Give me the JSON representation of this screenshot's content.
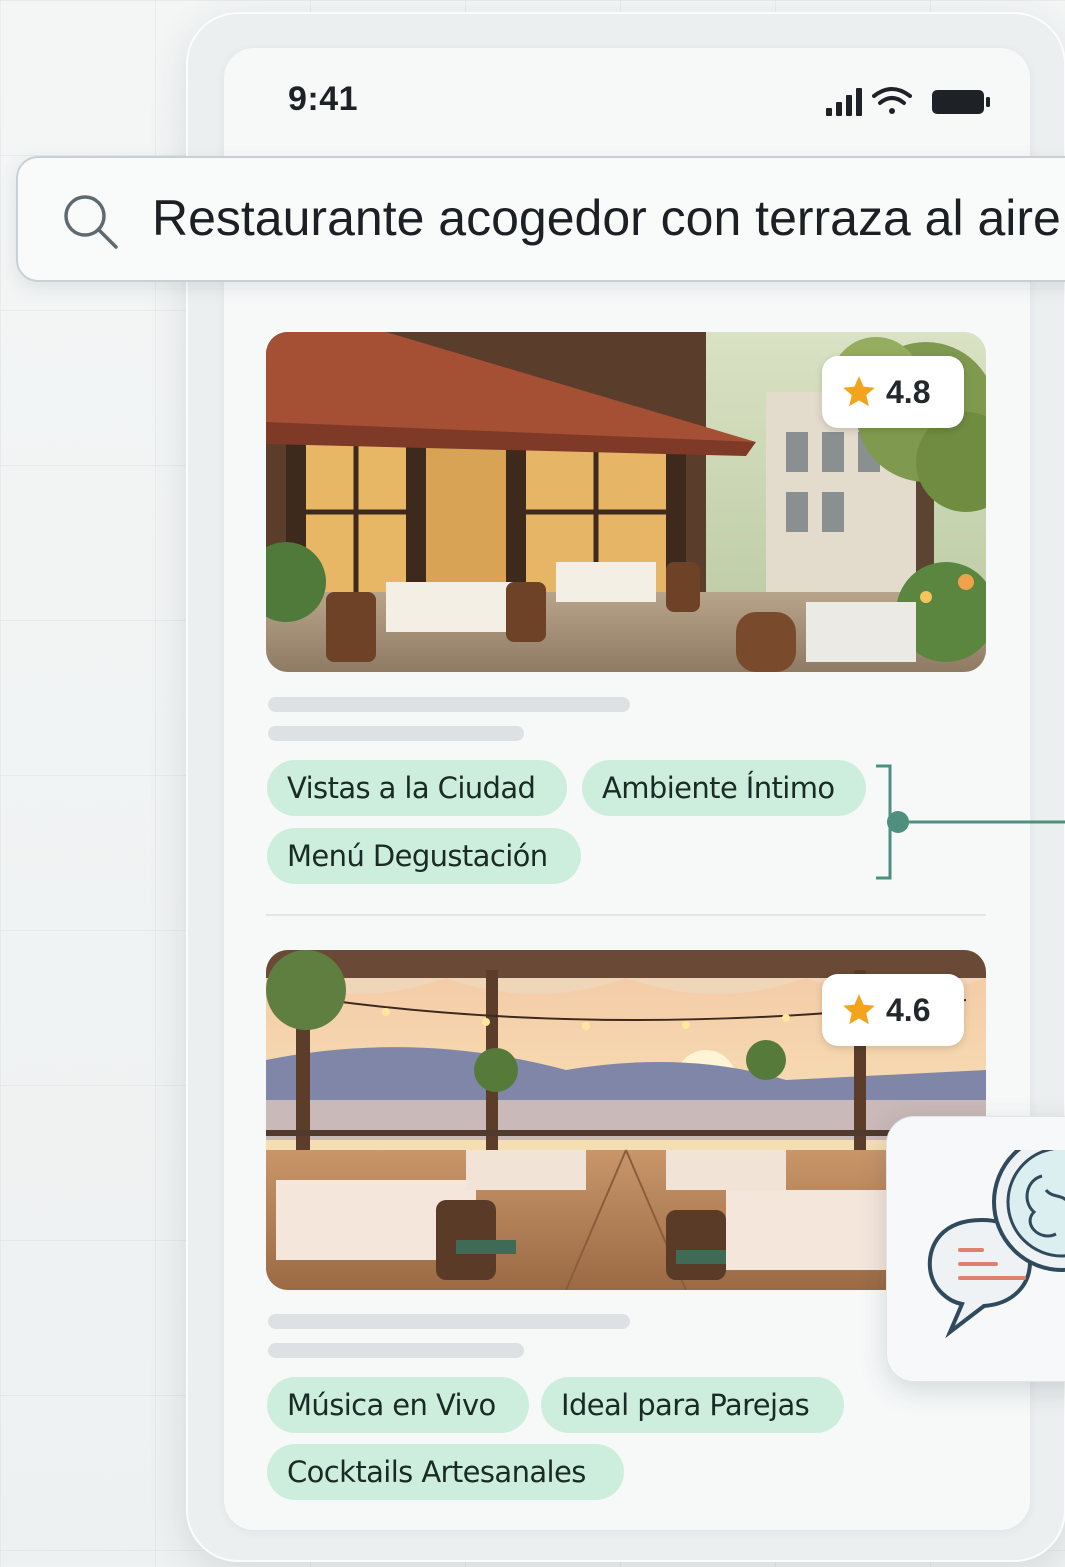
{
  "status_bar": {
    "time": "9:41",
    "icons": [
      "signal-icon",
      "wifi-icon",
      "battery-icon"
    ]
  },
  "search": {
    "query": "Restaurante acogedor con terraza al aire",
    "icon": "search-icon"
  },
  "results": [
    {
      "rating": "4.8",
      "image": "cafe-terrace-awning-illustration",
      "tags": [
        "Vistas a la Ciudad",
        "Ambiente Íntimo",
        "Menú Degustación"
      ]
    },
    {
      "rating": "4.6",
      "image": "sunset-pergola-terrace-illustration",
      "tags": [
        "Música en Vivo",
        "Ideal para Parejas",
        "Cocktails Artesanales"
      ]
    }
  ],
  "colors": {
    "chip_bg": "#cdeedd",
    "connector": "#4f8f7f",
    "star": "#f2a51c",
    "chat_accent": "#e08070"
  }
}
